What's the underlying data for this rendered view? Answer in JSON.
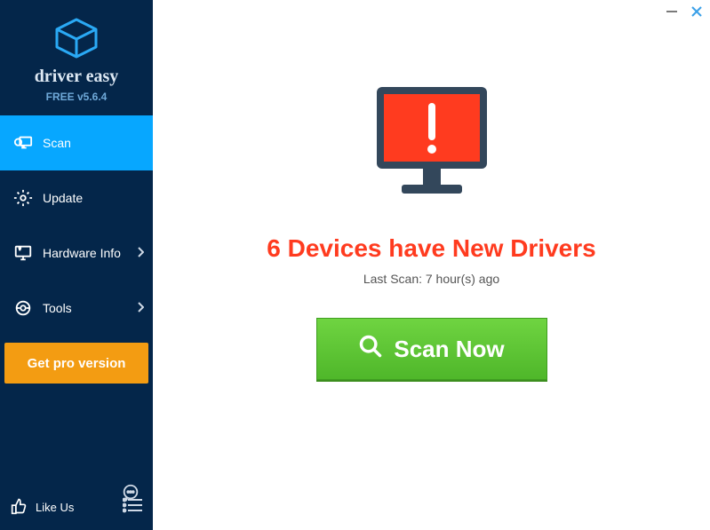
{
  "brand": {
    "name": "driver easy",
    "version": "FREE v5.6.4"
  },
  "sidebar": {
    "items": [
      {
        "label": "Scan"
      },
      {
        "label": "Update"
      },
      {
        "label": "Hardware Info"
      },
      {
        "label": "Tools"
      }
    ],
    "get_pro_label": "Get pro version",
    "likeus_label": "Like Us"
  },
  "main": {
    "device_count": "6",
    "headline_prefix": " Devices have New Drivers",
    "last_scan_label": "Last Scan: 7 hour(s) ago",
    "scan_button_label": "Scan Now"
  },
  "icons": {
    "logo": "logo-cube-icon",
    "scan": "magnify-monitor-icon",
    "update": "gear-refresh-icon",
    "hardware": "monitor-info-icon",
    "tools": "tools-icon",
    "feedback": "speech-bubble-icon",
    "likeus": "thumbs-up-icon",
    "menu": "hamburger-menu-icon",
    "minimize": "minimize-icon",
    "close": "close-icon",
    "scan_btn": "magnify-icon",
    "alert": "alert-icon",
    "chevron": "chevron-right-icon"
  },
  "colors": {
    "sidebar_bg": "#04264a",
    "active_bg": "#07a7ff",
    "pro_bg": "#f39c12",
    "headline": "#ff3b1f",
    "scan_btn": "#5bc130",
    "alert_screen": "#ff3b1f"
  }
}
